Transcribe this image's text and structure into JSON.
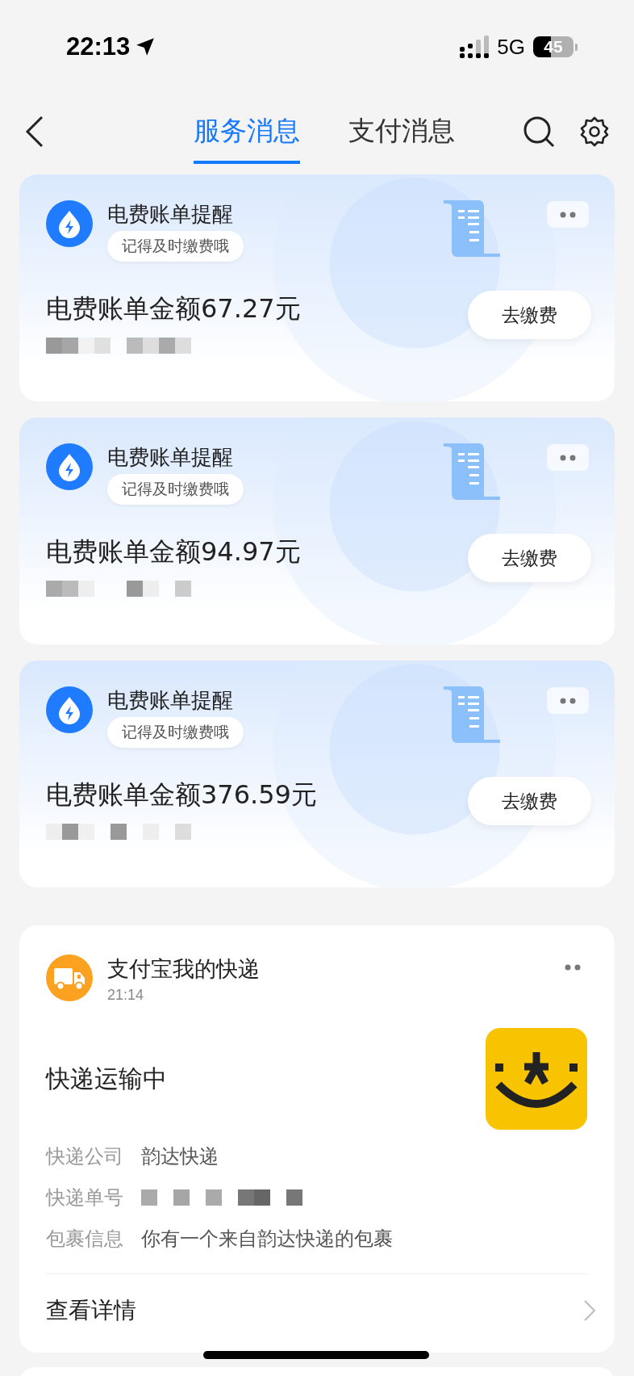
{
  "status_bar": {
    "time": "22:13",
    "network": "5G",
    "battery": "45"
  },
  "nav": {
    "tabs": [
      {
        "label": "服务消息",
        "selected": true
      },
      {
        "label": "支付消息",
        "selected": false
      }
    ]
  },
  "bill_cards": [
    {
      "title": "电费账单提醒",
      "subtitle": "记得及时缴费哦",
      "amount": "电费账单金额67.27元",
      "button": "去缴费"
    },
    {
      "title": "电费账单提醒",
      "subtitle": "记得及时缴费哦",
      "amount": "电费账单金额94.97元",
      "button": "去缴费"
    },
    {
      "title": "电费账单提醒",
      "subtitle": "记得及时缴费哦",
      "amount": "电费账单金额376.59元",
      "button": "去缴费"
    }
  ],
  "delivery_card": {
    "title": "支付宝我的快递",
    "time": "21:14",
    "status": "快递运输中",
    "details": [
      {
        "kind": "text",
        "label": "快递公司",
        "value": "韵达快递"
      },
      {
        "kind": "redacted",
        "label": "快递单号"
      },
      {
        "kind": "text",
        "label": "包裹信息",
        "value": "你有一个来自韵达快递的包裹"
      }
    ],
    "link": "查看详情"
  }
}
